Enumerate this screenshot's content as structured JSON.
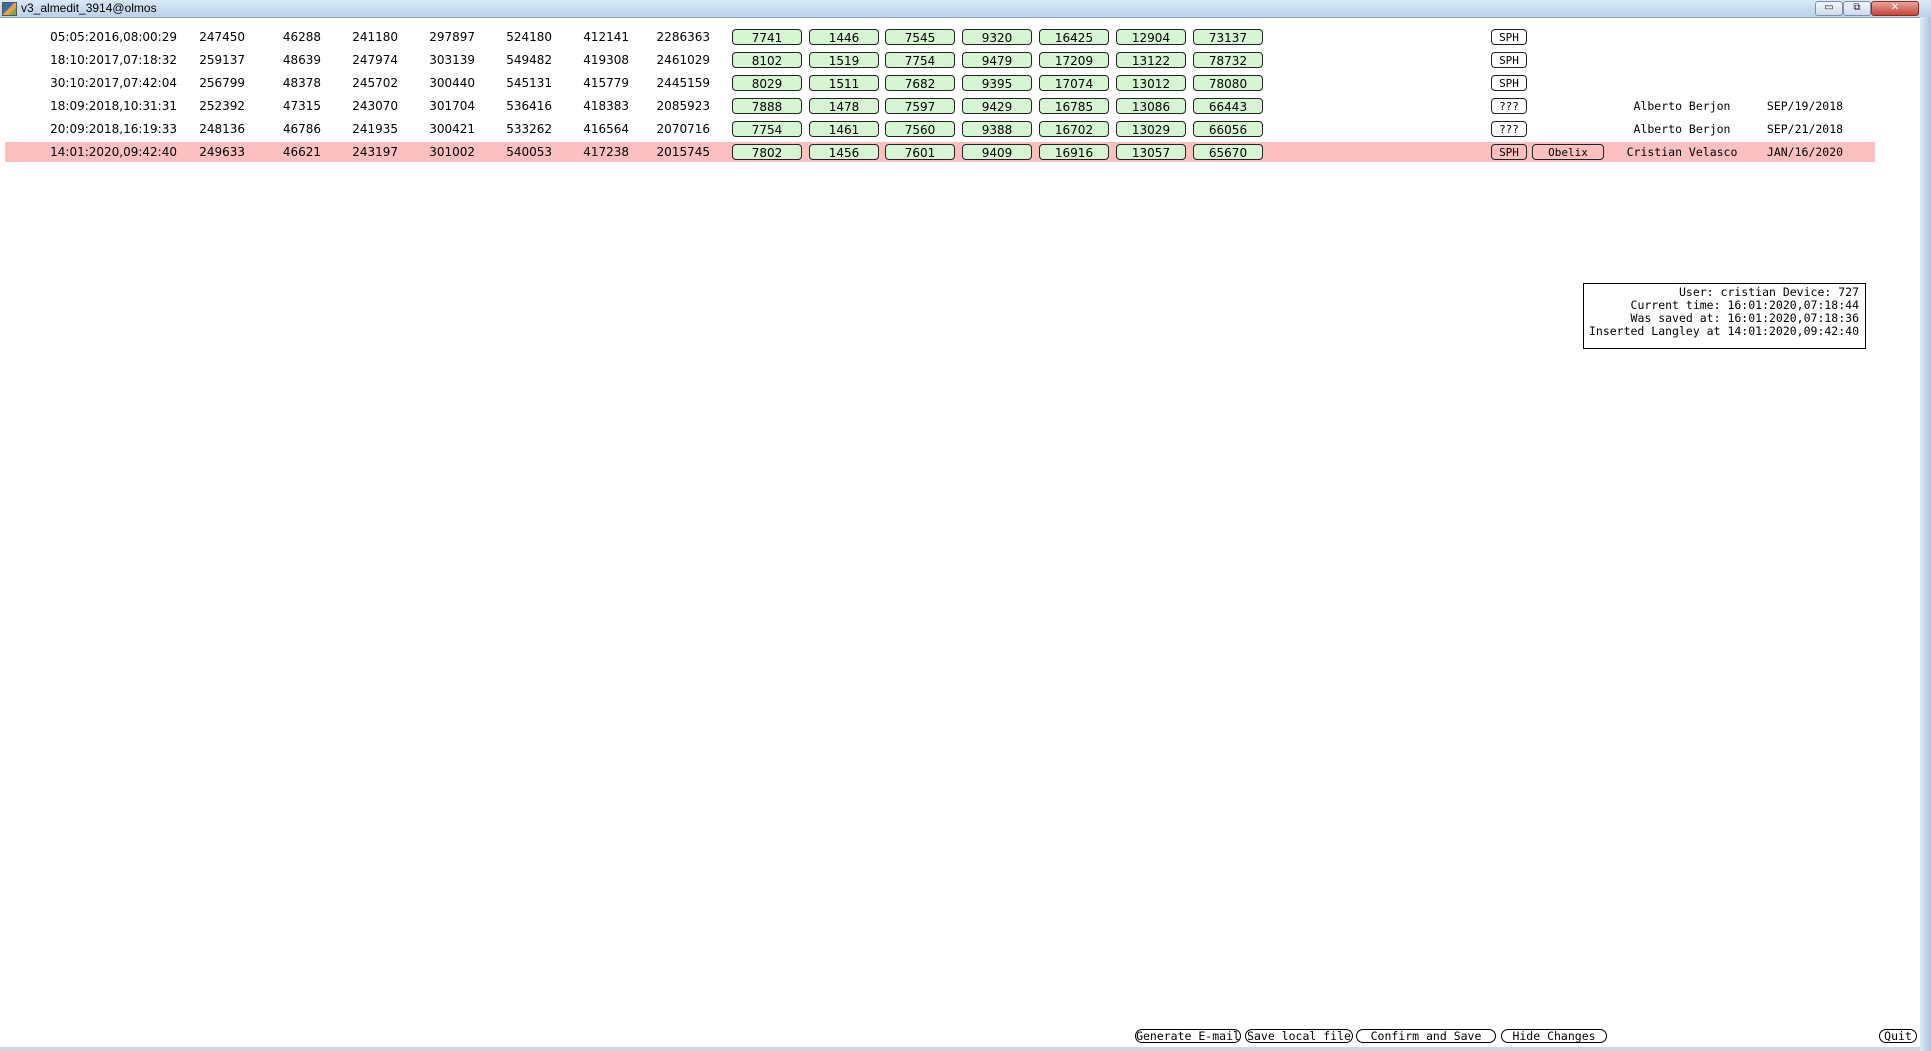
{
  "window": {
    "title": "v3_almedit_3914@olmos"
  },
  "controls": {
    "minimize": "▭",
    "restore": "⧉",
    "close": "✕"
  },
  "rows": [
    {
      "timestamp": "05:05:2016,08:00:29",
      "values": [
        "247450",
        "46288",
        "241180",
        "297897",
        "524180",
        "412141",
        "2286363"
      ],
      "boxes": [
        "7741",
        "1446",
        "7545",
        "9320",
        "16425",
        "12904",
        "73137"
      ],
      "tag": "SPH",
      "extra": "",
      "person": "",
      "date": "",
      "highlighted": false
    },
    {
      "timestamp": "18:10:2017,07:18:32",
      "values": [
        "259137",
        "48639",
        "247974",
        "303139",
        "549482",
        "419308",
        "2461029"
      ],
      "boxes": [
        "8102",
        "1519",
        "7754",
        "9479",
        "17209",
        "13122",
        "78732"
      ],
      "tag": "SPH",
      "extra": "",
      "person": "",
      "date": "",
      "highlighted": false
    },
    {
      "timestamp": "30:10:2017,07:42:04",
      "values": [
        "256799",
        "48378",
        "245702",
        "300440",
        "545131",
        "415779",
        "2445159"
      ],
      "boxes": [
        "8029",
        "1511",
        "7682",
        "9395",
        "17074",
        "13012",
        "78080"
      ],
      "tag": "SPH",
      "extra": "",
      "person": "",
      "date": "",
      "highlighted": false
    },
    {
      "timestamp": "18:09:2018,10:31:31",
      "values": [
        "252392",
        "47315",
        "243070",
        "301704",
        "536416",
        "418383",
        "2085923"
      ],
      "boxes": [
        "7888",
        "1478",
        "7597",
        "9429",
        "16785",
        "13086",
        "66443"
      ],
      "tag": "???",
      "extra": "",
      "person": "Alberto Berjon",
      "date": "SEP/19/2018",
      "highlighted": false
    },
    {
      "timestamp": "20:09:2018,16:19:33",
      "values": [
        "248136",
        "46786",
        "241935",
        "300421",
        "533262",
        "416564",
        "2070716"
      ],
      "boxes": [
        "7754",
        "1461",
        "7560",
        "9388",
        "16702",
        "13029",
        "66056"
      ],
      "tag": "???",
      "extra": "",
      "person": "Alberto Berjon",
      "date": "SEP/21/2018",
      "highlighted": false
    },
    {
      "timestamp": "14:01:2020,09:42:40",
      "values": [
        "249633",
        "46621",
        "243197",
        "301002",
        "540053",
        "417238",
        "2015745"
      ],
      "boxes": [
        "7802",
        "1456",
        "7601",
        "9409",
        "16916",
        "13057",
        "65670"
      ],
      "tag": "SPH",
      "extra": "Obelix",
      "person": "Cristian Velasco",
      "date": "JAN/16/2020",
      "highlighted": true
    }
  ],
  "info": {
    "line1": "User: cristian Device: 727",
    "line2": "Current time: 16:01:2020,07:18:44",
    "line3": "Was saved at: 16:01:2020,07:18:36",
    "line4": "Inserted Langley at 14:01:2020,09:42:40"
  },
  "buttons": {
    "generate_email": "Generate E-mail",
    "save_local": "Save local file",
    "confirm_save": "Confirm and Save",
    "hide_changes": "Hide Changes",
    "quit": "Quit"
  },
  "colors": {
    "highlight_row": "#fcc0c0",
    "value_box": "#d6f5d2"
  }
}
